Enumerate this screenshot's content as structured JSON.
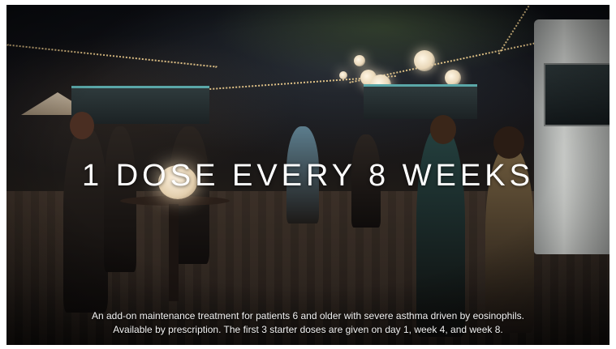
{
  "scene": {
    "description_icon": "night-street-party-photo"
  },
  "headline": {
    "text": "1 DOSE EVERY 8 WEEKS"
  },
  "caption": {
    "line1": "An add-on maintenance treatment for patients 6 and older with severe asthma driven by eosinophils.",
    "line2": "Available by prescription. The first 3 starter doses are given on day 1, week 4, and week 8."
  },
  "colors": {
    "text": "#ffffff",
    "string_lights": "#ffdc96",
    "stall_accent": "#5aa7a8"
  }
}
